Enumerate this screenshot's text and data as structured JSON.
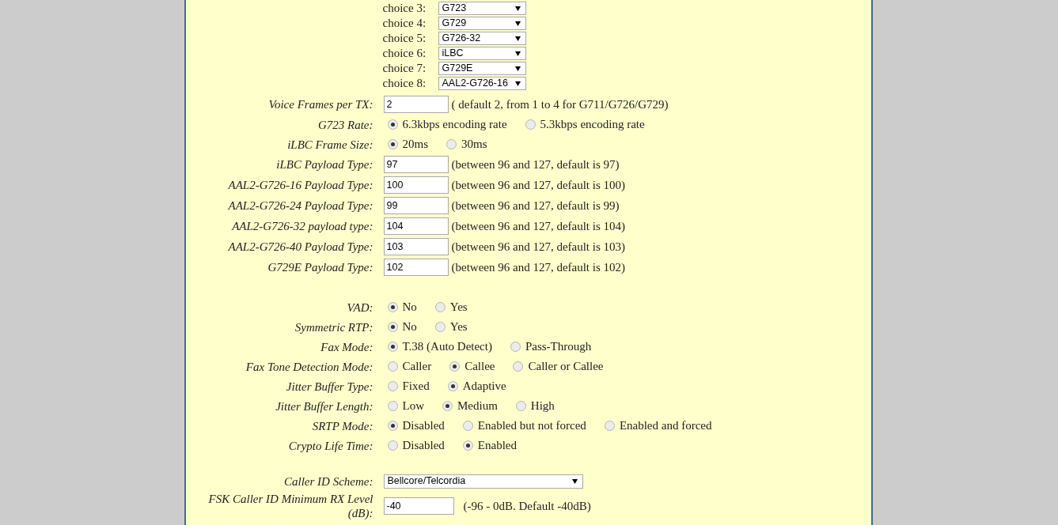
{
  "codec_choices": [
    {
      "label": "choice 3:",
      "value": "G723"
    },
    {
      "label": "choice 4:",
      "value": "G729"
    },
    {
      "label": "choice 5:",
      "value": "G726-32"
    },
    {
      "label": "choice 6:",
      "value": "iLBC"
    },
    {
      "label": "choice 7:",
      "value": "G729E"
    },
    {
      "label": "choice 8:",
      "value": "AAL2-G726-16"
    }
  ],
  "sections": [
    {
      "fields": [
        {
          "kind": "text",
          "label": "Voice Frames per TX:",
          "value": "2",
          "hint": "( default 2, from 1 to 4 for G711/G726/G729)"
        },
        {
          "kind": "radio",
          "label": "G723 Rate:",
          "options": [
            {
              "label": "6.3kbps encoding rate",
              "selected": true
            },
            {
              "label": "5.3kbps encoding rate",
              "selected": false
            }
          ]
        },
        {
          "kind": "radio",
          "label": "iLBC Frame Size:",
          "options": [
            {
              "label": "20ms",
              "selected": true
            },
            {
              "label": "30ms",
              "selected": false
            }
          ]
        },
        {
          "kind": "text",
          "label": "iLBC Payload Type:",
          "value": "97",
          "hint": "(between 96 and 127, default is 97)"
        },
        {
          "kind": "text",
          "label": "AAL2-G726-16 Payload Type:",
          "value": "100",
          "hint": "(between 96 and 127, default is 100)"
        },
        {
          "kind": "text",
          "label": "AAL2-G726-24 Payload Type:",
          "value": "99",
          "hint": "(between 96 and 127, default is 99)"
        },
        {
          "kind": "text",
          "label": "AAL2-G726-32 payload type:",
          "value": "104",
          "hint": "(between 96 and 127, default is 104)"
        },
        {
          "kind": "text",
          "label": "AAL2-G726-40 Payload Type:",
          "value": "103",
          "hint": "(between 96 and 127, default is 103)"
        },
        {
          "kind": "text",
          "label": "G729E Payload Type:",
          "value": "102",
          "hint": "(between 96 and 127, default is 102)"
        }
      ]
    },
    {
      "fields": [
        {
          "kind": "radio",
          "label": "VAD:",
          "options": [
            {
              "label": "No",
              "selected": true
            },
            {
              "label": "Yes",
              "selected": false
            }
          ]
        },
        {
          "kind": "radio",
          "label": "Symmetric RTP:",
          "options": [
            {
              "label": "No",
              "selected": true
            },
            {
              "label": "Yes",
              "selected": false
            }
          ]
        },
        {
          "kind": "radio",
          "label": "Fax Mode:",
          "options": [
            {
              "label": "T.38 (Auto Detect)",
              "selected": true
            },
            {
              "label": "Pass-Through",
              "selected": false
            }
          ]
        },
        {
          "kind": "radio",
          "label": "Fax Tone Detection Mode:",
          "options": [
            {
              "label": "Caller",
              "selected": false
            },
            {
              "label": "Callee",
              "selected": true
            },
            {
              "label": "Caller or Callee",
              "selected": false
            }
          ]
        },
        {
          "kind": "radio",
          "label": "Jitter Buffer Type:",
          "options": [
            {
              "label": "Fixed",
              "selected": false
            },
            {
              "label": "Adaptive",
              "selected": true
            }
          ]
        },
        {
          "kind": "radio",
          "label": "Jitter Buffer Length:",
          "options": [
            {
              "label": "Low",
              "selected": false
            },
            {
              "label": "Medium",
              "selected": true
            },
            {
              "label": "High",
              "selected": false
            }
          ]
        },
        {
          "kind": "radio",
          "label": "SRTP Mode:",
          "options": [
            {
              "label": "Disabled",
              "selected": true
            },
            {
              "label": "Enabled but not forced",
              "selected": false
            },
            {
              "label": "Enabled and forced",
              "selected": false
            }
          ]
        },
        {
          "kind": "radio",
          "label": "Crypto Life Time:",
          "options": [
            {
              "label": "Disabled",
              "selected": false
            },
            {
              "label": "Enabled",
              "selected": true
            }
          ]
        }
      ]
    },
    {
      "fields": [
        {
          "kind": "select",
          "label": "Caller ID Scheme:",
          "value": "Bellcore/Telcordia"
        },
        {
          "kind": "text_wide",
          "label": "FSK Caller ID Minimum RX Level (dB):",
          "value": "-40",
          "hint": "(-96 - 0dB. Default -40dB)"
        }
      ]
    }
  ]
}
